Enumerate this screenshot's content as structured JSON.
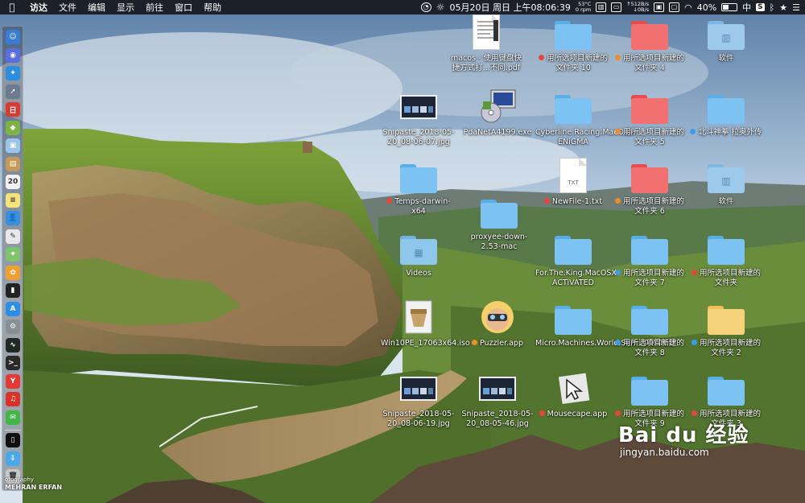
{
  "menubar": {
    "apple_icon": "apple-icon",
    "items": [
      "访达",
      "文件",
      "编辑",
      "显示",
      "前往",
      "窗口",
      "帮助"
    ],
    "status": {
      "datetime": "05月20日 周日 上午08:06:39",
      "temperature": "53°C",
      "fan": "0 rpm",
      "net_up": "↑512B/s",
      "net_down": "↓0B/s",
      "battery": "40%",
      "battery_level": 0.4,
      "input_method": "中"
    }
  },
  "desktop": {
    "icons": [
      {
        "label": "macos - 使用键盘快捷方式打...不同.pdf",
        "kind": "pdf",
        "tag": ""
      },
      {
        "label": "用所选项目新建的文件夹 10",
        "kind": "folder-blue",
        "tag": "#e8453c"
      },
      {
        "label": "用所选项目新建的文件夹 4",
        "kind": "folder-red",
        "tag": "#f08c2a"
      },
      {
        "label": "软件",
        "kind": "folder-apps",
        "tag": ""
      },
      {
        "label": "Snipaste_2018-05-20_08-06-07.jpg",
        "kind": "screenshot",
        "tag": ""
      },
      {
        "label": "PdaNetA4199.exe",
        "kind": "exe",
        "tag": ""
      },
      {
        "label": "Cyberline.Racing.MacOSX-ENiGMA",
        "kind": "folder-blue",
        "tag": ""
      },
      {
        "label": "用所选项目新建的文件夹 5",
        "kind": "folder-red",
        "tag": "#f08c2a"
      },
      {
        "label": "北斗神拳 拉奥外传",
        "kind": "folder-blue",
        "tag": "#3c9be8"
      },
      {
        "label": "Temps-darwin-x64",
        "kind": "folder-blue",
        "tag": "#e8453c"
      },
      {
        "label": "proxyee-down-2.53-mac",
        "kind": "folder-blue",
        "tag": ""
      },
      {
        "label": "NewFile-1.txt",
        "kind": "txt",
        "tag": "#e8453c"
      },
      {
        "label": "用所选项目新建的文件夹 6",
        "kind": "folder-red",
        "tag": "#f08c2a"
      },
      {
        "label": "软件",
        "kind": "folder-apps",
        "tag": ""
      },
      {
        "label": "Videos",
        "kind": "folder-video",
        "tag": ""
      },
      {
        "label": "For.The.King.MacOSX-ACTiVATED",
        "kind": "folder-blue",
        "tag": ""
      },
      {
        "label": "用所选项目新建的文件夹 7",
        "kind": "folder-blue",
        "tag": "#3c9be8"
      },
      {
        "label": "用所选项目新建的文件夹",
        "kind": "folder-blue",
        "tag": "#e8453c"
      },
      {
        "label": "Win10PE_17063x64.iso",
        "kind": "iso",
        "tag": ""
      },
      {
        "label": "Puzzler.app",
        "kind": "app-puzzler",
        "tag": "#f08c2a"
      },
      {
        "label": "Micro.Machines.World.Seri...TiVATED",
        "kind": "folder-blue",
        "tag": ""
      },
      {
        "label": "用所选项目新建的文件夹 8",
        "kind": "folder-blue",
        "tag": "#3c9be8"
      },
      {
        "label": "用所选项目新建的文件夹 2",
        "kind": "folder-yellow",
        "tag": "#3c9be8"
      },
      {
        "label": "Snipaste_2018-05-20_08-06-19.jpg",
        "kind": "screenshot",
        "tag": ""
      },
      {
        "label": "Snipaste_2018-05-20_08-05-46.jpg",
        "kind": "screenshot",
        "tag": ""
      },
      {
        "label": "Mousecape.app",
        "kind": "app-mousecape",
        "tag": "#e8453c"
      },
      {
        "label": "用所选项目新建的文件夹 9",
        "kind": "folder-blue",
        "tag": "#e8453c"
      },
      {
        "label": "用所选项目新建的文件夹 3",
        "kind": "folder-blue",
        "tag": "#e8453c"
      }
    ]
  },
  "dock": {
    "apps": [
      {
        "name": "finder-icon",
        "color": "#3a7bd5",
        "glyph": "☺"
      },
      {
        "name": "siri-icon",
        "color": "#5b6ee1",
        "glyph": "◉"
      },
      {
        "name": "safari-icon",
        "color": "#2d8ee0",
        "glyph": "✦"
      },
      {
        "name": "launchpad-icon",
        "color": "#6d7b8e",
        "glyph": "➚"
      },
      {
        "name": "calendar-red-icon",
        "color": "#d93b30",
        "glyph": "日"
      },
      {
        "name": "android-icon",
        "color": "#7cb342",
        "glyph": "◆"
      },
      {
        "name": "preview-icon",
        "color": "#9cc3e8",
        "glyph": "▣"
      },
      {
        "name": "notes-brown-icon",
        "color": "#c49a5a",
        "glyph": "▤"
      },
      {
        "name": "calendar-icon",
        "color": "#f2f2f2",
        "glyph": "20"
      },
      {
        "name": "notes-icon",
        "color": "#f5e27a",
        "glyph": "≡"
      },
      {
        "name": "contacts-icon",
        "color": "#3b8ed8",
        "glyph": "👤"
      },
      {
        "name": "textedit-icon",
        "color": "#e8e8e8",
        "glyph": "✎"
      },
      {
        "name": "maps-icon",
        "color": "#7fc56b",
        "glyph": "⌖"
      },
      {
        "name": "photos-icon",
        "color": "#f0a030",
        "glyph": "✿"
      },
      {
        "name": "terminal-dark-icon",
        "color": "#222222",
        "glyph": "▮"
      },
      {
        "name": "app-store-icon",
        "color": "#2b8fe8",
        "glyph": "A"
      },
      {
        "name": "system-preferences-icon",
        "color": "#8a8f96",
        "glyph": "⚙"
      },
      {
        "name": "activity-monitor-icon",
        "color": "#1f2a25",
        "glyph": "∿"
      },
      {
        "name": "terminal-icon",
        "color": "#2a2a2a",
        "glyph": ">_"
      },
      {
        "name": "yandex-icon",
        "color": "#e53935",
        "glyph": "Y"
      },
      {
        "name": "netease-music-icon",
        "color": "#d8322a",
        "glyph": "♫"
      },
      {
        "name": "wechat-icon",
        "color": "#44b549",
        "glyph": "✉"
      },
      {
        "name": "iphone-icon",
        "color": "#111111",
        "glyph": "▯"
      },
      {
        "name": "downloads-folder-icon",
        "color": "#4aa8e8",
        "glyph": "⇩"
      },
      {
        "name": "trash-icon",
        "color": "#c8c8c8",
        "glyph": "🗑"
      }
    ]
  },
  "overlay": {
    "photo_credit_line1": "otography",
    "photo_credit_line2": "MEHRAN ERFAN",
    "watermark_main": "Bai du 经验",
    "watermark_sub": "jingyan.baidu.com"
  }
}
